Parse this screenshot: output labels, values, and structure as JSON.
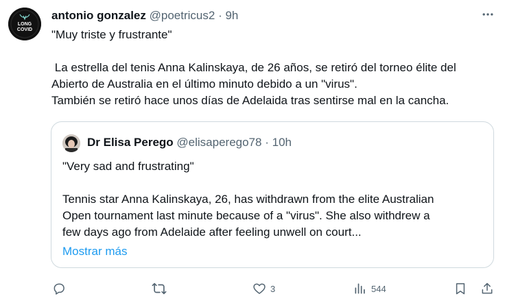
{
  "tweet": {
    "author_name": "antonio gonzalez",
    "handle": "@poetricus2",
    "separator": "·",
    "time": "9h",
    "text_lines": [
      "\"Muy triste y frustrante\"",
      " La estrella del tenis Anna Kalinskaya, de 26 años, se retiró del torneo élite del",
      "Abierto de Australia en el último minuto debido a un \"virus\".",
      "También se retiró hace unos días de Adelaida tras sentirse mal en la cancha."
    ],
    "avatar_text": [
      "LONG",
      "COVID"
    ]
  },
  "quote": {
    "author_name": "Dr Elisa Perego",
    "handle": "@elisaperego78",
    "separator": "·",
    "time": "10h",
    "text_lines": [
      "\"Very sad and frustrating\"",
      "Tennis star Anna Kalinskaya, 26, has withdrawn from the elite Australian",
      "Open tournament last minute because of a \"virus\". She also withdrew a",
      "few days ago from Adelaide after feeling unwell on court..."
    ],
    "show_more": "Mostrar más"
  },
  "actions": {
    "reply_icon": "reply-icon",
    "retweet_icon": "retweet-icon",
    "like_icon": "heart-icon",
    "like_count": "3",
    "views_icon": "views-icon",
    "views_count": "544",
    "bookmark_icon": "bookmark-icon",
    "share_icon": "share-icon"
  },
  "colors": {
    "text": "#0f1419",
    "secondary": "#536471",
    "link": "#1d9bf0",
    "border": "#cfd9de"
  }
}
